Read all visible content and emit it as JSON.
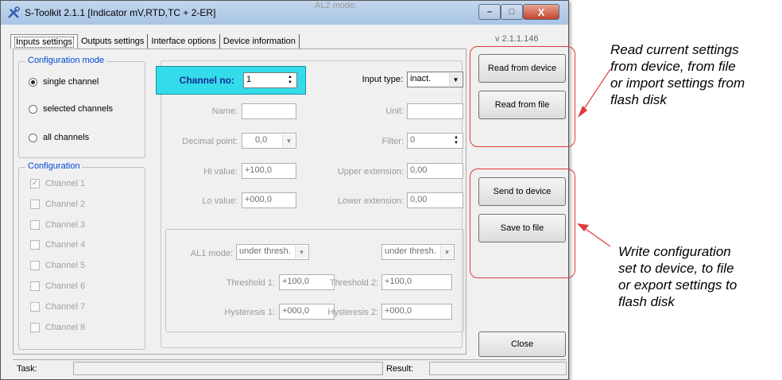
{
  "window": {
    "title": "S-Toolkit  2.1.1   [Indicator  mV,RTD,TC + 2-ER]",
    "controls": {
      "minimize": "–",
      "maximize": "□",
      "close": "X"
    },
    "version": "v 2.1.1.146"
  },
  "tabs": [
    "Inputs settings",
    "Outputs settings",
    "Interface options",
    "Device information"
  ],
  "config_mode": {
    "legend": "Configuration mode",
    "options": [
      "single channel",
      "selected channels",
      "all channels"
    ],
    "selected": "single channel"
  },
  "configuration": {
    "legend": "Configuration",
    "channels": [
      {
        "label": "Channel 1",
        "checked": true
      },
      {
        "label": "Channel 2",
        "checked": false
      },
      {
        "label": "Channel 3",
        "checked": false
      },
      {
        "label": "Channel 4",
        "checked": false
      },
      {
        "label": "Channel 5",
        "checked": false
      },
      {
        "label": "Channel 6",
        "checked": false
      },
      {
        "label": "Channel 7",
        "checked": false
      },
      {
        "label": "Channel 8",
        "checked": false
      }
    ]
  },
  "channel": {
    "label": "Channel no:",
    "value": "1"
  },
  "input_type": {
    "label": "Input type:",
    "value": "inact."
  },
  "fields": {
    "name": {
      "label": "Name:",
      "value": ""
    },
    "unit": {
      "label": "Unit:",
      "value": ""
    },
    "decimal_point": {
      "label": "Decimal point:",
      "value": "0,0"
    },
    "filter": {
      "label": "Filter:",
      "value": "0"
    },
    "hi_value": {
      "label": "Hi value:",
      "value": "+100,0"
    },
    "upper_extension": {
      "label": "Upper extension:",
      "value": "0,00"
    },
    "lo_value": {
      "label": "Lo value:",
      "value": "+000,0"
    },
    "lower_extension": {
      "label": "Lower extension:",
      "value": "0,00"
    }
  },
  "alarms": {
    "al1_mode": {
      "label": "AL1 mode:",
      "value": "under thresh."
    },
    "al2_mode": {
      "label": "AL2 mode:",
      "value": "under thresh."
    },
    "threshold1": {
      "label": "Threshold 1:",
      "value": "+100,0"
    },
    "threshold2": {
      "label": "Threshold 2:",
      "value": "+100,0"
    },
    "hysteresis1": {
      "label": "Hysteresis 1:",
      "value": "+000,0"
    },
    "hysteresis2": {
      "label": "Hysteresis 2:",
      "value": "+000,0"
    }
  },
  "buttons": {
    "read_device": "Read from device",
    "read_file": "Read from file",
    "send_device": "Send to device",
    "save_file": "Save to file",
    "close": "Close"
  },
  "status": {
    "task_label": "Task:",
    "result_label": "Result:"
  },
  "annotations": {
    "read": [
      "Read current settings",
      "from device, from file",
      "or import settings from",
      "flash disk"
    ],
    "write": [
      "Write configuration",
      "set to device, to file",
      "or export settings to",
      "flash disk"
    ]
  },
  "colors": {
    "accent_cyan": "#34dbe8",
    "annotation_red": "#e03a3a",
    "legend_blue": "#0046d5"
  },
  "icons": {
    "app": "tools-icon",
    "dropdown": "chevron-down-icon",
    "spinner": "spin-arrows-icon"
  }
}
